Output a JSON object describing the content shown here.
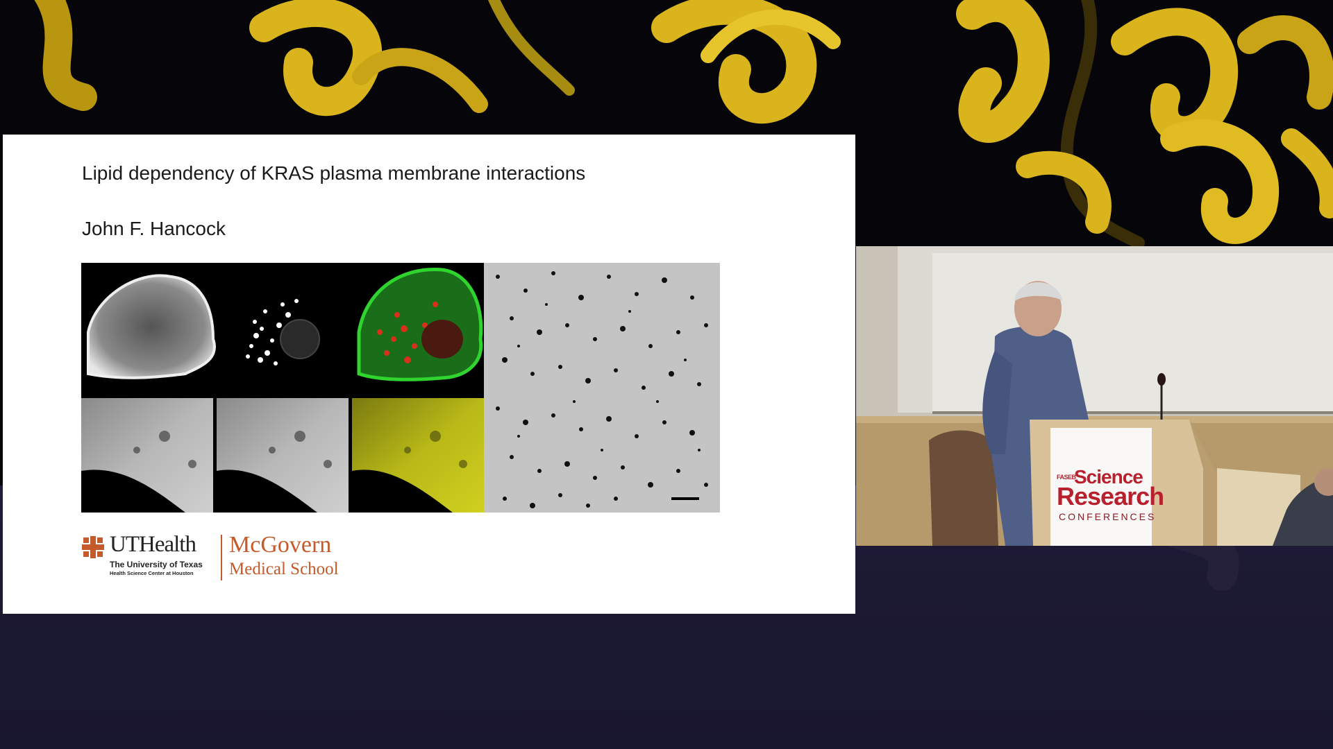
{
  "slide": {
    "title": "Lipid dependency of KRAS plasma membrane interactions",
    "author": "John F. Hancock"
  },
  "logo": {
    "left_name": "UTHealth",
    "left_sub1": "The University of Texas",
    "left_sub2": "Health Science Center at Houston",
    "right_line1": "McGovern",
    "right_line2": "Medical School"
  },
  "podium_sign": {
    "org": "FASEB",
    "line1": "Science",
    "line2": "Research",
    "line3": "CONFERENCES"
  },
  "colors": {
    "accent_logo": "#c55a2a",
    "sign_red": "#b8202e",
    "ribbon_yellow": "#d9b41c",
    "bottom_bg": "#1c1932"
  },
  "icons": [
    "protein-ribbon-icon",
    "uthealth-cross-icon",
    "scale-bar-icon"
  ]
}
